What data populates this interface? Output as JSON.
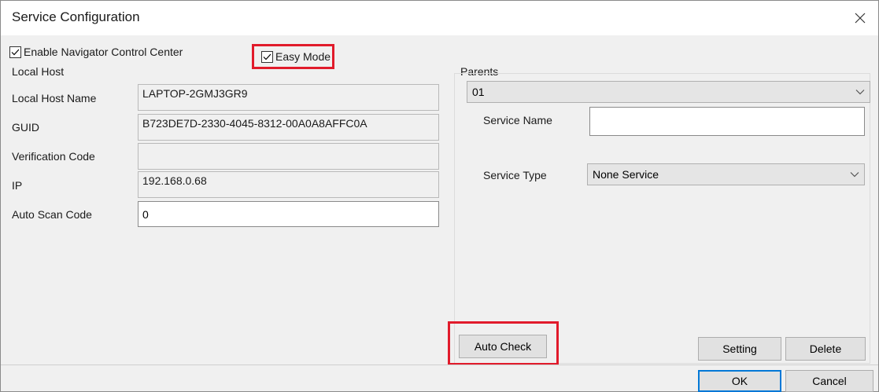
{
  "window": {
    "title": "Service Configuration"
  },
  "top": {
    "enable_navigator": {
      "label": "Enable Navigator Control Center",
      "checked": true
    },
    "easy_mode": {
      "label": "Easy Mode",
      "checked": true
    }
  },
  "local_host": {
    "group_label": "Local Host",
    "fields": {
      "host_name": {
        "label": "Local Host Name",
        "value": "LAPTOP-2GMJ3GR9"
      },
      "guid": {
        "label": "GUID",
        "value": "B723DE7D-2330-4045-8312-00A0A8AFFC0A"
      },
      "verification_code": {
        "label": "Verification Code",
        "value": ""
      },
      "ip": {
        "label": "IP",
        "value": "192.168.0.68"
      },
      "auto_scan_code": {
        "label": "Auto Scan Code",
        "value": "0"
      }
    }
  },
  "parents": {
    "group_label": "Parents",
    "selected": "01",
    "service_name": {
      "label": "Service Name",
      "value": ""
    },
    "service_type": {
      "label": "Service Type",
      "selected": "None Service"
    }
  },
  "buttons": {
    "auto_check": "Auto Check",
    "setting": "Setting",
    "delete": "Delete",
    "ok": "OK",
    "cancel": "Cancel"
  },
  "colors": {
    "highlight": "#e11b2b",
    "default_button_border": "#0078d7",
    "dialog_bg": "#f0f0f0"
  }
}
